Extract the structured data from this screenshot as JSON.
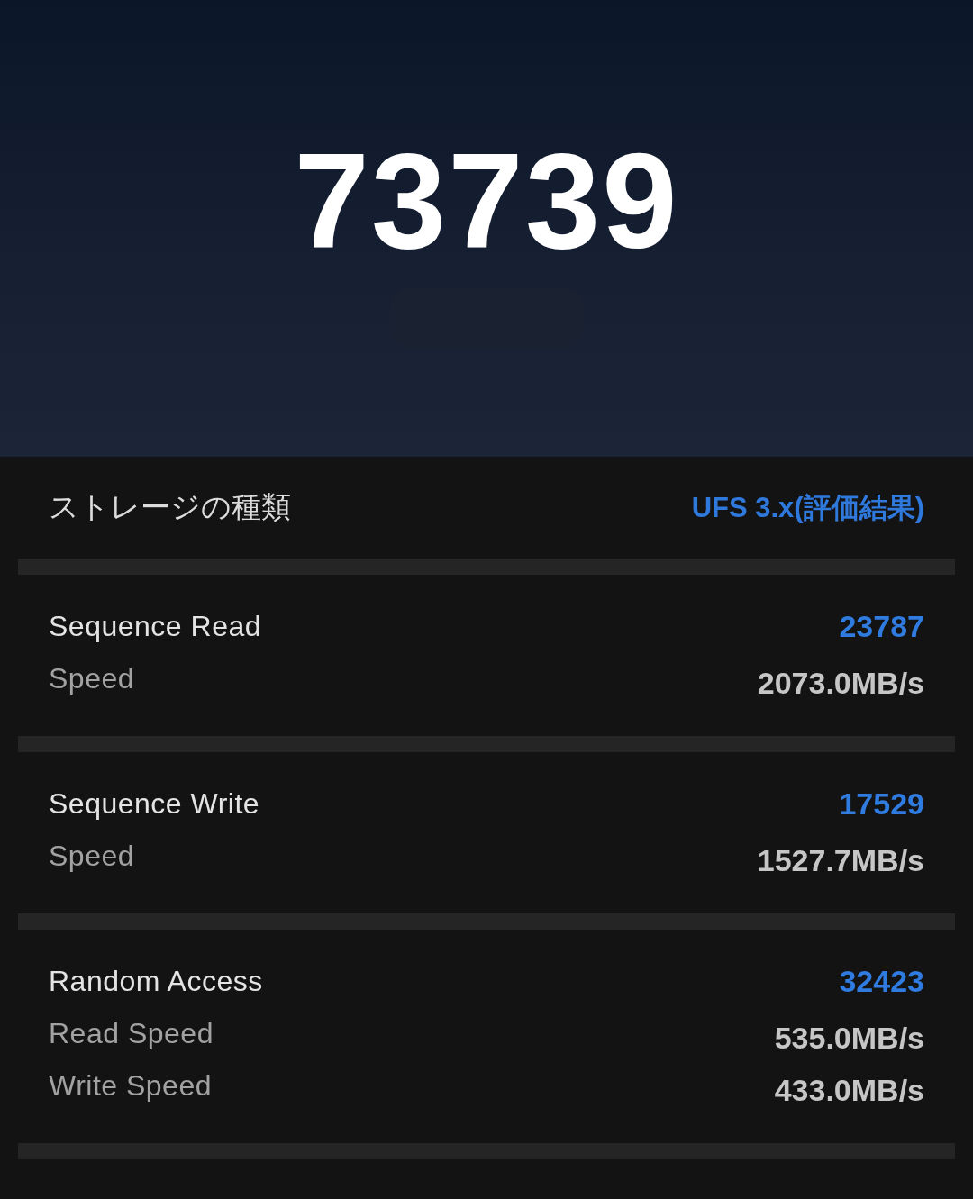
{
  "score": "73739",
  "storage_type": {
    "label": "ストレージの種類",
    "value": "UFS 3.x(評価結果)"
  },
  "sections": [
    {
      "title": "Sequence Read",
      "score": "23787",
      "lines": [
        {
          "label": "Speed",
          "value": "2073.0MB/s"
        }
      ]
    },
    {
      "title": "Sequence Write",
      "score": "17529",
      "lines": [
        {
          "label": "Speed",
          "value": "1527.7MB/s"
        }
      ]
    },
    {
      "title": "Random Access",
      "score": "32423",
      "lines": [
        {
          "label": "Read Speed",
          "value": "535.0MB/s"
        },
        {
          "label": "Write Speed",
          "value": "433.0MB/s"
        }
      ]
    }
  ]
}
